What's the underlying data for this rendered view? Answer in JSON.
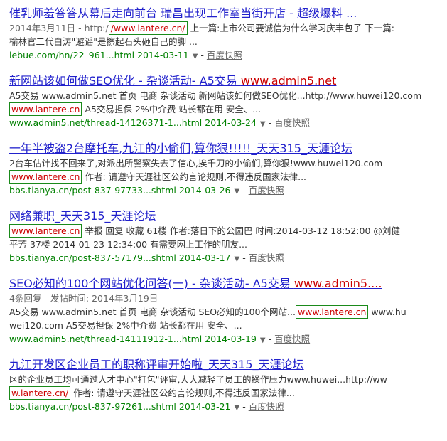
{
  "results": [
    {
      "title": "催乳师羞答答从幕后走向前台 瑞昌出现工作室当街开店 - 超级爆料 ...",
      "date": "2014年3月11日 - http:/",
      "hl": "/www.lantere.cn/",
      "abstract1": "上一篇:上市公司要诚信为什么学习庆丰包子 下一篇:",
      "abstract2": "榆林官二代白涛\"避谣\"是擦起石头砸自己的脚 ...",
      "url": "lebue.com/hn/22_961...html 2014-03-11",
      "snap": "百度快照"
    },
    {
      "title_a": "新网站该如何做SEO优化 - 杂谈活动- A5交易 ",
      "title_red": "www.admin5.net",
      "abstract1": "A5交易 www.admin5.net 首页 电商 杂谈活动 新网站该如何做SEO优化...http://www.huwei120.com",
      "hl": "www.lantere.cn",
      "abstract2": " A5交易担保 2%中介费 站长都在用 安全、...",
      "url": "www.admin5.net/thread-14126371-1...html 2014-03-24",
      "snap": "百度快照"
    },
    {
      "title": "一年半被盗2台摩托车,九江的小偷们,算你狠!!!!!_天天315_天涯论坛",
      "abstract1": "2台车估计找不回来了,对派出所警察失去了信心,挨千刀的小偷们,算你狠!www.huwei120.com",
      "hl": "www.lantere.cn",
      "abstract2": " 作者: 请遵守天涯社区公约言论规则,不得违反国家法律...",
      "url": "bbs.tianya.cn/post-837-97733...shtml 2014-03-26",
      "snap": "百度快照"
    },
    {
      "title": "网络兼职_天天315_天涯论坛",
      "hl": "www.lantere.cn",
      "abstract1": " 举报 回复 收藏 61楼 作者:落日下的公园巴 时间:2014-03-12 18:52:00 @刘健",
      "abstract2": "平芳 37楼 2014-01-23 12:34:00 有需要网上工作的朋友...",
      "url": "bbs.tianya.cn/post-837-57179...shtml 2014-03-17",
      "snap": "百度快照"
    },
    {
      "title_a": "SEO必知的100个网站优化问答(一) - 杂谈活动- A5交易 ",
      "title_red": "www.admin5....",
      "meta": "4条回复 - 发帖时间: 2014年3月19日",
      "abstract1": "A5交易 www.admin5.net 首页 电商 杂谈活动 SEO必知的100个网站...",
      "hl": "www.lantere.cn",
      "abstract1b": " www.hu",
      "abstract2": "wei120.com A5交易担保 2%中介费 站长都在用 安全、...",
      "url": "www.admin5.net/thread-14111912-1...html 2014-03-19",
      "snap": "百度快照"
    },
    {
      "title": "九江开发区企业员工的职称评审开始啦_天天315_天涯论坛",
      "abstract1": "区的企业员工均可通过人才中心\"打包\"评审,大大减轻了员工的操作压力www.huwei...http://ww",
      "hl": "w.lantere.cn/",
      "abstract2": " 作者: 请遵守天涯社区公约言论规则,不得违反国家法律...",
      "url": "bbs.tianya.cn/post-837-97261...shtml 2014-03-21",
      "snap": "百度快照"
    }
  ]
}
